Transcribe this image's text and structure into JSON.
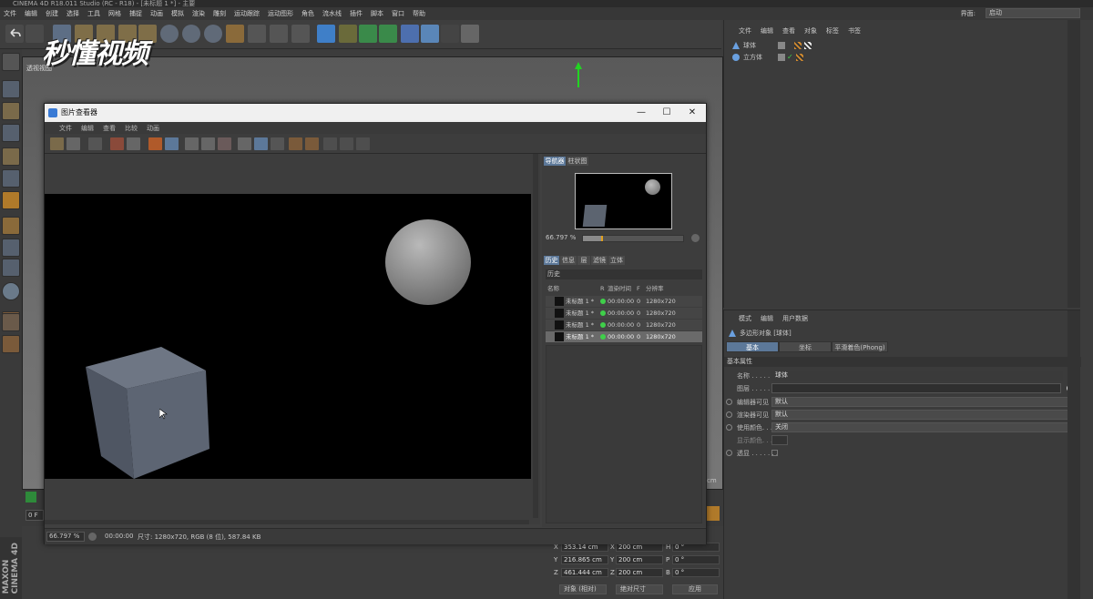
{
  "app": {
    "title": "CINEMA 4D R18.011 Studio (RC - R18) - [未标题 1 *] - 主要",
    "menu": [
      "文件",
      "编辑",
      "创建",
      "选择",
      "工具",
      "网格",
      "捕捉",
      "动画",
      "模拟",
      "渲染",
      "雕刻",
      "运动跟踪",
      "运动图形",
      "角色",
      "流水线",
      "插件",
      "脚本",
      "窗口",
      "帮助"
    ],
    "layout_label": "界面:",
    "layout_value": "启动"
  },
  "watermark": "秒懂视频",
  "viewport": {
    "label": "透视视图"
  },
  "brand": {
    "line1": "MAXON",
    "line2": "CINEMA 4D"
  },
  "object_manager": {
    "menu": [
      "文件",
      "编辑",
      "查看",
      "对象",
      "标签",
      "书签"
    ],
    "objects": [
      {
        "name": "球体"
      },
      {
        "name": "立方体"
      }
    ]
  },
  "attribute_manager": {
    "menu": [
      "模式",
      "编辑",
      "用户数据"
    ],
    "object_label": "多边形对象 [球体]",
    "tabs": [
      "基本",
      "坐标",
      "平滑着色(Phong)"
    ],
    "section": "基本属性",
    "props": [
      {
        "label": "名称 . . . . . . .",
        "value": "球体"
      },
      {
        "label": "图层 . . . . . . .",
        "value": ""
      },
      {
        "label": "编辑器可见",
        "value": "默认"
      },
      {
        "label": "渲染器可见",
        "value": "默认"
      },
      {
        "label": "使用颜色. . . .",
        "value": "关闭"
      },
      {
        "label": "显示颜色. . . .",
        "value": ""
      },
      {
        "label": "透显 . . . . . . .",
        "value": ""
      }
    ]
  },
  "coords": {
    "rows": [
      {
        "a": "X",
        "av": "353.14 cm",
        "b": "X",
        "bv": "200 cm",
        "c": "H",
        "cv": "0 °"
      },
      {
        "a": "Y",
        "av": "216.865 cm",
        "b": "Y",
        "bv": "200 cm",
        "c": "P",
        "cv": "0 °"
      },
      {
        "a": "Z",
        "av": "461.444 cm",
        "b": "Z",
        "bv": "200 cm",
        "c": "B",
        "cv": "0 °"
      }
    ],
    "mode1": "对象 (相对)",
    "mode2": "绝对尺寸",
    "apply": "应用",
    "unit": "cm"
  },
  "timeline": {
    "frame": "0 F"
  },
  "picture_viewer": {
    "title": "图片查看器",
    "menu": [
      "文件",
      "编辑",
      "查看",
      "比较",
      "动画"
    ],
    "nav_tabs": [
      "导航器",
      "柱状图"
    ],
    "zoom": "66.797 %",
    "panel_tabs": [
      "历史",
      "信息",
      "层",
      "滤镜",
      "立体"
    ],
    "history_label": "历史",
    "columns": {
      "name": "名称",
      "r": "R",
      "time": "渲染时间",
      "f": "F",
      "res": "分辨率"
    },
    "history": [
      {
        "name": "未标题 1 *",
        "time": "00:00:00",
        "f": "0",
        "res": "1280x720"
      },
      {
        "name": "未标题 1 *",
        "time": "00:00:00",
        "f": "0",
        "res": "1280x720"
      },
      {
        "name": "未标题 1 *",
        "time": "00:00:00",
        "f": "0",
        "res": "1280x720"
      },
      {
        "name": "未标题 1 *",
        "time": "00:00:00",
        "f": "0",
        "res": "1280x720"
      }
    ],
    "status": {
      "zoom": "66.797 %",
      "time": "00:00:00",
      "info": "尺寸: 1280x720, RGB (8 位), 587.84 KB"
    }
  }
}
